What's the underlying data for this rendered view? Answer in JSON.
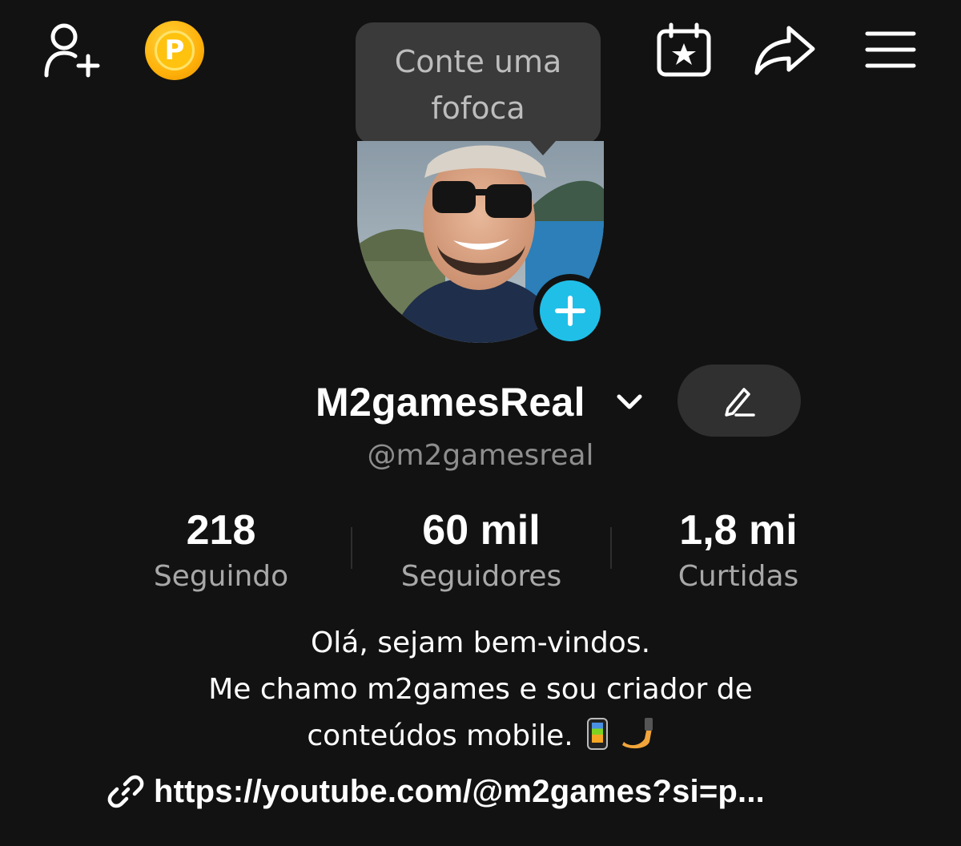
{
  "topbar": {
    "add_friend_icon": "person-add-icon",
    "coin_icon": "coin-icon",
    "coin_letter": "P",
    "calendar_icon": "calendar-star-icon",
    "share_icon": "share-arrow-icon",
    "menu_icon": "hamburger-menu-icon"
  },
  "tooltip": {
    "line1": "Conte uma",
    "line2": "fofoca"
  },
  "profile": {
    "display_name": "M2gamesReal",
    "handle": "@m2gamesreal"
  },
  "stats": {
    "following": {
      "value": "218",
      "label": "Seguindo"
    },
    "followers": {
      "value": "60 mil",
      "label": "Seguidores"
    },
    "likes": {
      "value": "1,8 mi",
      "label": "Curtidas"
    }
  },
  "bio": {
    "line1": "Olá, sejam bem-vindos.",
    "line2": "Me chamo m2games e sou criador de",
    "line3": "conteúdos mobile."
  },
  "link": {
    "text": "https://youtube.com/@m2games?si=p..."
  },
  "colors": {
    "background": "#121212",
    "accent_blue": "#20bfe8",
    "coin_gold": "#ffb10a",
    "muted_text": "#8e8e8e"
  }
}
